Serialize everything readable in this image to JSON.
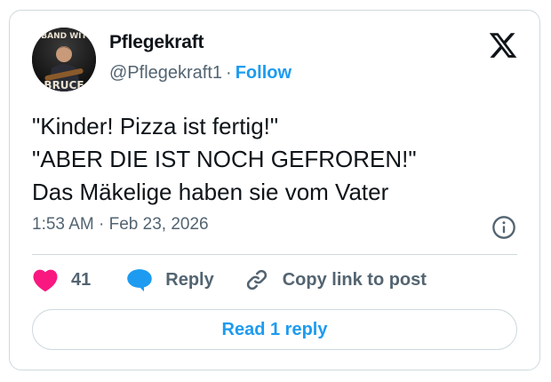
{
  "author": {
    "name": "Pflegekraft",
    "handle": "@Pflegekraft1",
    "separator": "·",
    "follow_label": "Follow",
    "avatar_text_top": "BAND WIT",
    "avatar_text_bottom": "BRUCE"
  },
  "post": {
    "lines": [
      "\"Kinder! Pizza ist fertig!\"",
      "\"ABER DIE IST NOCH GEFROREN!\"",
      "Das Mäkelige haben sie vom Vater"
    ],
    "time": "1:53 AM",
    "separator": "·",
    "date": "Feb 23, 2026"
  },
  "actions": {
    "like_count": "41",
    "reply_label": "Reply",
    "copy_label": "Copy link to post"
  },
  "read_replies_label": "Read 1 reply",
  "icons": {
    "logo": "x-logo-icon",
    "info": "info-icon",
    "like": "heart-icon",
    "reply": "speech-bubble-icon",
    "copy": "link-icon"
  },
  "colors": {
    "accent": "#1d9bf0",
    "like": "#f91880",
    "secondary_text": "#536471",
    "border": "#cfd9de"
  }
}
